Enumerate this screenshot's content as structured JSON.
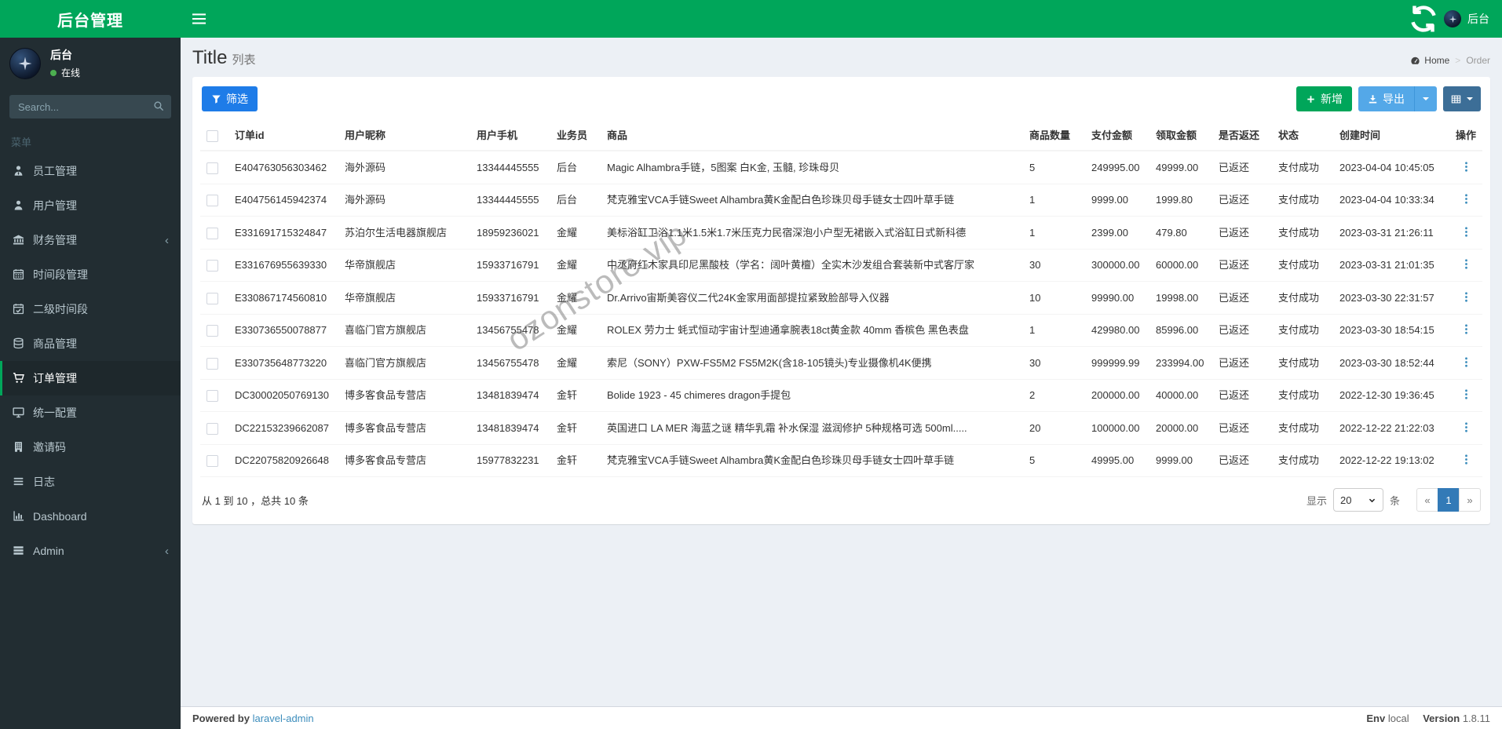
{
  "app": {
    "title": "后台管理"
  },
  "navbar": {
    "username": "后台"
  },
  "sidebar": {
    "user": {
      "name": "后台",
      "status": "在线"
    },
    "search_placeholder": "Search...",
    "menu_header": "菜单",
    "items": [
      {
        "key": "staff",
        "icon": "user-tie-icon",
        "label": "员工管理",
        "active": false,
        "has_children": false
      },
      {
        "key": "users",
        "icon": "user-icon",
        "label": "用户管理",
        "active": false,
        "has_children": false
      },
      {
        "key": "finance",
        "icon": "bank-icon",
        "label": "财务管理",
        "active": false,
        "has_children": true
      },
      {
        "key": "timeslot",
        "icon": "calendar-icon",
        "label": "时间段管理",
        "active": false,
        "has_children": false
      },
      {
        "key": "sub-timeslot",
        "icon": "calendar-check-icon",
        "label": "二级时间段",
        "active": false,
        "has_children": false
      },
      {
        "key": "products",
        "icon": "database-icon",
        "label": "商品管理",
        "active": false,
        "has_children": false
      },
      {
        "key": "orders",
        "icon": "cart-icon",
        "label": "订单管理",
        "active": true,
        "has_children": false
      },
      {
        "key": "config",
        "icon": "desktop-icon",
        "label": "统一配置",
        "active": false,
        "has_children": false
      },
      {
        "key": "invite-code",
        "icon": "building-icon",
        "label": "邀请码",
        "active": false,
        "has_children": false
      },
      {
        "key": "log",
        "icon": "list-icon",
        "label": "日志",
        "active": false,
        "has_children": false
      },
      {
        "key": "dashboard",
        "icon": "bar-chart-icon",
        "label": "Dashboard",
        "active": false,
        "has_children": false
      },
      {
        "key": "admin",
        "icon": "tasks-icon",
        "label": "Admin",
        "active": false,
        "has_children": true
      }
    ]
  },
  "header": {
    "title": "Title",
    "subtitle": "列表",
    "breadcrumb_home": "Home",
    "breadcrumb_current": "Order"
  },
  "toolbar": {
    "filter_label": "筛选",
    "add_label": "新增",
    "export_label": "导出"
  },
  "table": {
    "columns": [
      "订单id",
      "用户昵称",
      "用户手机",
      "业务员",
      "商品",
      "商品数量",
      "支付金额",
      "领取金额",
      "是否返还",
      "状态",
      "创建时间",
      "操作"
    ],
    "rows": [
      {
        "order_id": "E404763056303462",
        "nickname": "海外源码",
        "phone": "13344445555",
        "salesman": "后台",
        "product": "Magic Alhambra手链，5图案 白K金, 玉髓, 珍珠母贝",
        "quantity": "5",
        "pay_amount": "249995.00",
        "receive_amount": "49999.00",
        "returned": "已返还",
        "status": "支付成功",
        "created_at": "2023-04-04 10:45:05"
      },
      {
        "order_id": "E404756145942374",
        "nickname": "海外源码",
        "phone": "13344445555",
        "salesman": "后台",
        "product": "梵克雅宝VCA手链Sweet Alhambra黄K金配白色珍珠贝母手链女士四叶草手链",
        "quantity": "1",
        "pay_amount": "9999.00",
        "receive_amount": "1999.80",
        "returned": "已返还",
        "status": "支付成功",
        "created_at": "2023-04-04 10:33:34"
      },
      {
        "order_id": "E331691715324847",
        "nickname": "苏泊尔生活电器旗舰店",
        "phone": "18959236021",
        "salesman": "金耀",
        "product": "美标浴缸卫浴1.1米1.5米1.7米压克力民宿深泡小户型无裙嵌入式浴缸日式新科德",
        "quantity": "1",
        "pay_amount": "2399.00",
        "receive_amount": "479.80",
        "returned": "已返还",
        "status": "支付成功",
        "created_at": "2023-03-31 21:26:11"
      },
      {
        "order_id": "E331676955639330",
        "nickname": "华帝旗舰店",
        "phone": "15933716791",
        "salesman": "金耀",
        "product": "中丞府红木家具印尼黑酸枝（学名：阔叶黄檀）全实木沙发组合套装新中式客厅家",
        "quantity": "30",
        "pay_amount": "300000.00",
        "receive_amount": "60000.00",
        "returned": "已返还",
        "status": "支付成功",
        "created_at": "2023-03-31 21:01:35"
      },
      {
        "order_id": "E330867174560810",
        "nickname": "华帝旗舰店",
        "phone": "15933716791",
        "salesman": "金耀",
        "product": "Dr.Arrivo宙斯美容仪二代24K金家用面部提拉紧致脸部导入仪器",
        "quantity": "10",
        "pay_amount": "99990.00",
        "receive_amount": "19998.00",
        "returned": "已返还",
        "status": "支付成功",
        "created_at": "2023-03-30 22:31:57"
      },
      {
        "order_id": "E330736550078877",
        "nickname": "喜临门官方旗舰店",
        "phone": "13456755478",
        "salesman": "金耀",
        "product": "ROLEX 劳力士 蚝式恒动宇宙计型迪通拿腕表18ct黄金款 40mm 香槟色 黑色表盘",
        "quantity": "1",
        "pay_amount": "429980.00",
        "receive_amount": "85996.00",
        "returned": "已返还",
        "status": "支付成功",
        "created_at": "2023-03-30 18:54:15"
      },
      {
        "order_id": "E330735648773220",
        "nickname": "喜临门官方旗舰店",
        "phone": "13456755478",
        "salesman": "金耀",
        "product": "索尼（SONY）PXW-FS5M2 FS5M2K(含18-105镜头)专业摄像机4K便携",
        "quantity": "30",
        "pay_amount": "999999.99",
        "receive_amount": "233994.00",
        "returned": "已返还",
        "status": "支付成功",
        "created_at": "2023-03-30 18:52:44"
      },
      {
        "order_id": "DC30002050769130",
        "nickname": "博多客食品专营店",
        "phone": "13481839474",
        "salesman": "金轩",
        "product": "Bolide 1923 - 45 chimeres dragon手提包",
        "quantity": "2",
        "pay_amount": "200000.00",
        "receive_amount": "40000.00",
        "returned": "已返还",
        "status": "支付成功",
        "created_at": "2022-12-30 19:36:45"
      },
      {
        "order_id": "DC22153239662087",
        "nickname": "博多客食品专营店",
        "phone": "13481839474",
        "salesman": "金轩",
        "product": "英国进口 LA MER 海蓝之谜 精华乳霜 补水保湿 滋润修护 5种规格可选 500ml.....",
        "quantity": "20",
        "pay_amount": "100000.00",
        "receive_amount": "20000.00",
        "returned": "已返还",
        "status": "支付成功",
        "created_at": "2022-12-22 21:22:03"
      },
      {
        "order_id": "DC22075820926648",
        "nickname": "博多客食品专营店",
        "phone": "15977832231",
        "salesman": "金轩",
        "product": "梵克雅宝VCA手链Sweet Alhambra黄K金配白色珍珠贝母手链女士四叶草手链",
        "quantity": "5",
        "pay_amount": "49995.00",
        "receive_amount": "9999.00",
        "returned": "已返还",
        "status": "支付成功",
        "created_at": "2022-12-22 19:13:02"
      }
    ]
  },
  "table_footer": {
    "summary": "从 1 到 10 ，总共 10 条",
    "per_page_prefix": "显示",
    "per_page": "20",
    "per_page_suffix": "条"
  },
  "pagination": {
    "prev": "«",
    "current": "1",
    "next": "»"
  },
  "watermark": "ozonstore.vip",
  "footer": {
    "powered_by": "Powered by",
    "powered_link": "laravel-admin",
    "env_label": "Env",
    "env_value": "local",
    "version_label": "Version",
    "version_value": "1.8.11"
  },
  "colors": {
    "navbar_green": "#00a65a",
    "sidebar_dark": "#222d32",
    "filter_blue": "#1e7ce8",
    "export_blue": "#54a8e8",
    "columns_dark_blue": "#3c6e97",
    "add_green": "#00a65a",
    "link_blue": "#3c8dbc",
    "active_page_blue": "#337ab7",
    "content_bg": "#ecf0f5"
  }
}
